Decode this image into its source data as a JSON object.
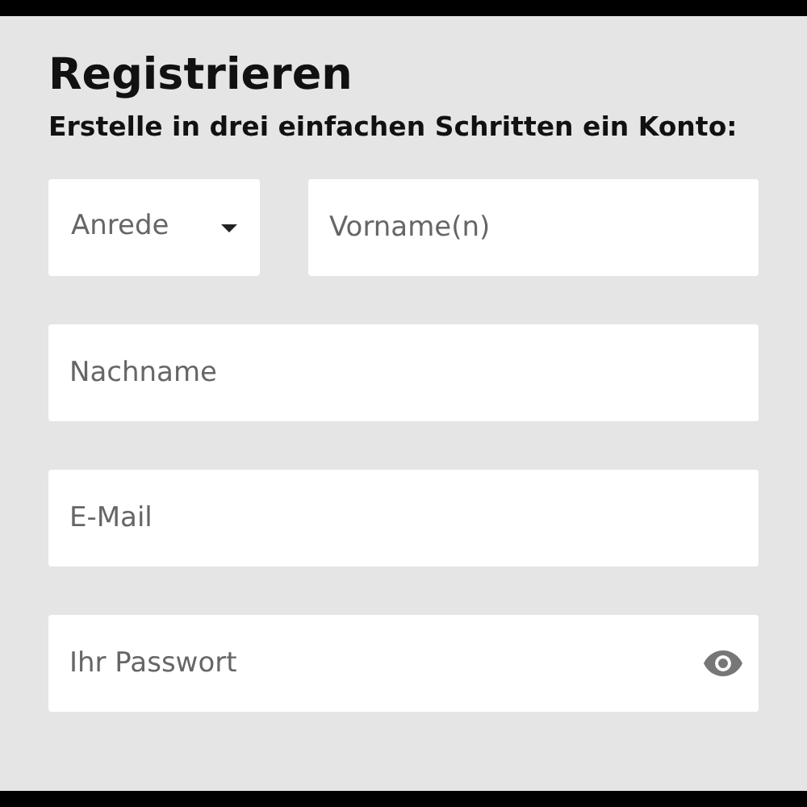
{
  "title": "Registrieren",
  "subtitle": "Erstelle in drei einfachen Schritten ein Konto:",
  "fields": [
    {
      "kind": "select",
      "placeholder": "Anrede"
    },
    {
      "kind": "text",
      "placeholder": "Vorname(n)"
    },
    {
      "kind": "text",
      "placeholder": "Nachname"
    },
    {
      "kind": "email",
      "placeholder": "E-Mail"
    },
    {
      "kind": "password",
      "placeholder": "Ihr Passwort"
    }
  ]
}
